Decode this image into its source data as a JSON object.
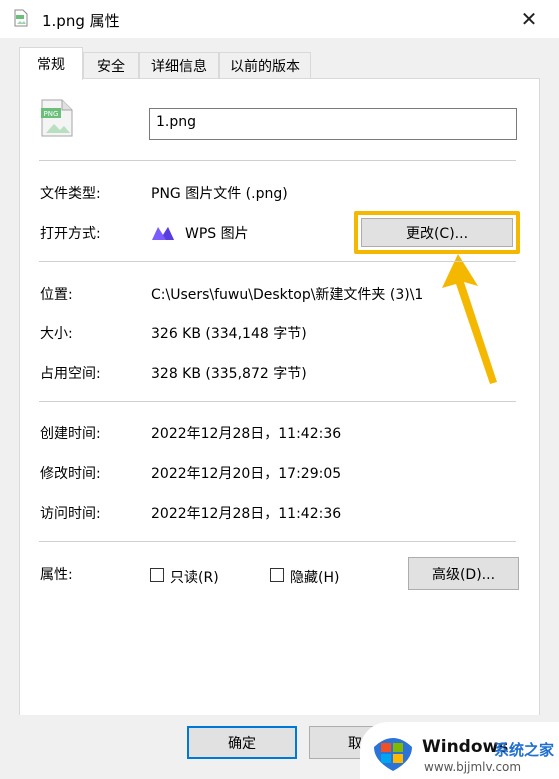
{
  "window": {
    "title": "1.png 属性",
    "close_glyph": "✕"
  },
  "tabs": [
    {
      "label": "常规"
    },
    {
      "label": "安全"
    },
    {
      "label": "详细信息"
    },
    {
      "label": "以前的版本"
    }
  ],
  "file": {
    "icon_text": "PNG",
    "name": "1.png"
  },
  "type": {
    "label": "文件类型:",
    "value": "PNG 图片文件 (.png)"
  },
  "open_with": {
    "label": "打开方式:",
    "app": "WPS 图片",
    "change_button": "更改(C)..."
  },
  "location": {
    "label": "位置:",
    "value": "C:\\Users\\fuwu\\Desktop\\新建文件夹 (3)\\1"
  },
  "size": {
    "label": "大小:",
    "value": "326 KB (334,148 字节)"
  },
  "size_on_disk": {
    "label": "占用空间:",
    "value": "328 KB (335,872 字节)"
  },
  "created": {
    "label": "创建时间:",
    "value": "2022年12月28日，11:42:36"
  },
  "modified": {
    "label": "修改时间:",
    "value": "2022年12月20日，17:29:05"
  },
  "accessed": {
    "label": "访问时间:",
    "value": "2022年12月28日，11:42:36"
  },
  "attributes": {
    "label": "属性:",
    "readonly": "只读(R)",
    "hidden": "隐藏(H)",
    "advanced_button": "高级(D)..."
  },
  "footer": {
    "ok_button": "确定",
    "cancel_button_partial": "取"
  },
  "watermark": {
    "brand": "Windows",
    "site_cn": "系统之家",
    "url": "www.bjjmlv.com"
  },
  "colors": {
    "highlight": "#f5b800",
    "ok_border": "#0078d7"
  }
}
